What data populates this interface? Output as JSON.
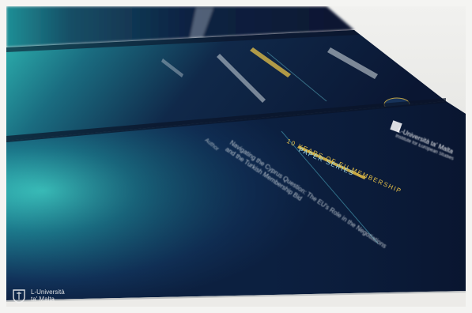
{
  "photo": {
    "subject": "brochures-fanned-out",
    "colors": {
      "navy": "#0d1a33",
      "teal": "#2aa6a6",
      "gold": "#e7c148",
      "background": "#ececea"
    }
  },
  "brochure": {
    "years_label": "10 YEARS OF EU MEMBERSHIP",
    "series_label": "PAPER SERIES",
    "title": "Navigating the Cyprus Question: The EU's Role in the Negotiations and the Turkish Membership Bid",
    "author": "Author",
    "university_name": "L-Università ta' Malta",
    "institute_name": "Institute for European Studies"
  },
  "watermark": {
    "line1": "L-Università",
    "line2": "ta' Malta",
    "icon": "university-crest-icon"
  }
}
